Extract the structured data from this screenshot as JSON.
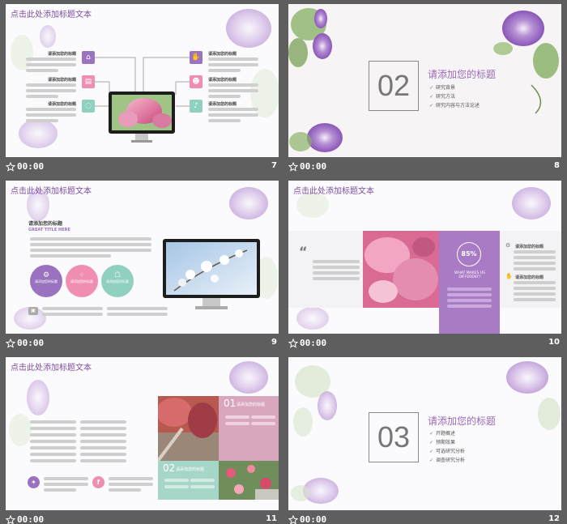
{
  "slides": [
    {
      "number": "7",
      "time": "00:00",
      "title": "点击此处添加标题文本",
      "labels": [
        "请添加您的标题",
        "请添加您的标题",
        "请添加您的标题",
        "请添加您的标题",
        "请添加您的标题",
        "请添加您的标题"
      ]
    },
    {
      "number": "8",
      "time": "00:00",
      "section_number": "02",
      "section_title": "请添加您的标题",
      "bullets": [
        "研究背景",
        "研究方法",
        "研究内容与方法论述"
      ]
    },
    {
      "number": "9",
      "time": "00:00",
      "title": "点击此处添加标题文本",
      "heading": "请添加您的标题",
      "subheading": "GREAT TITLE HERE",
      "circle_text": [
        "请添加您的标题",
        "请添加您的标题",
        "请添加您的标题"
      ]
    },
    {
      "number": "10",
      "time": "00:00",
      "title": "点击此处添加标题文本",
      "percent": "85%",
      "question": "WHAT MAKES US DIFFERENT?",
      "labels": [
        "请添加您的标题",
        "请添加您的标题"
      ]
    },
    {
      "number": "11",
      "time": "00:00",
      "title": "点击此处添加标题文本",
      "box1_num": "01",
      "box1_title": "请添加您的标题",
      "box2_num": "02",
      "box2_title": "请添加您的标题"
    },
    {
      "number": "12",
      "time": "00:00",
      "section_number": "03",
      "section_title": "请添加您的标题",
      "bullets": [
        "开题概述",
        "预期效果",
        "可选研究分析",
        "调查研究分析"
      ]
    }
  ],
  "colors": {
    "purple": "#9b72bf",
    "pink": "#f08db2",
    "teal": "#8fd0c0",
    "bg": "#5e5e5e"
  }
}
